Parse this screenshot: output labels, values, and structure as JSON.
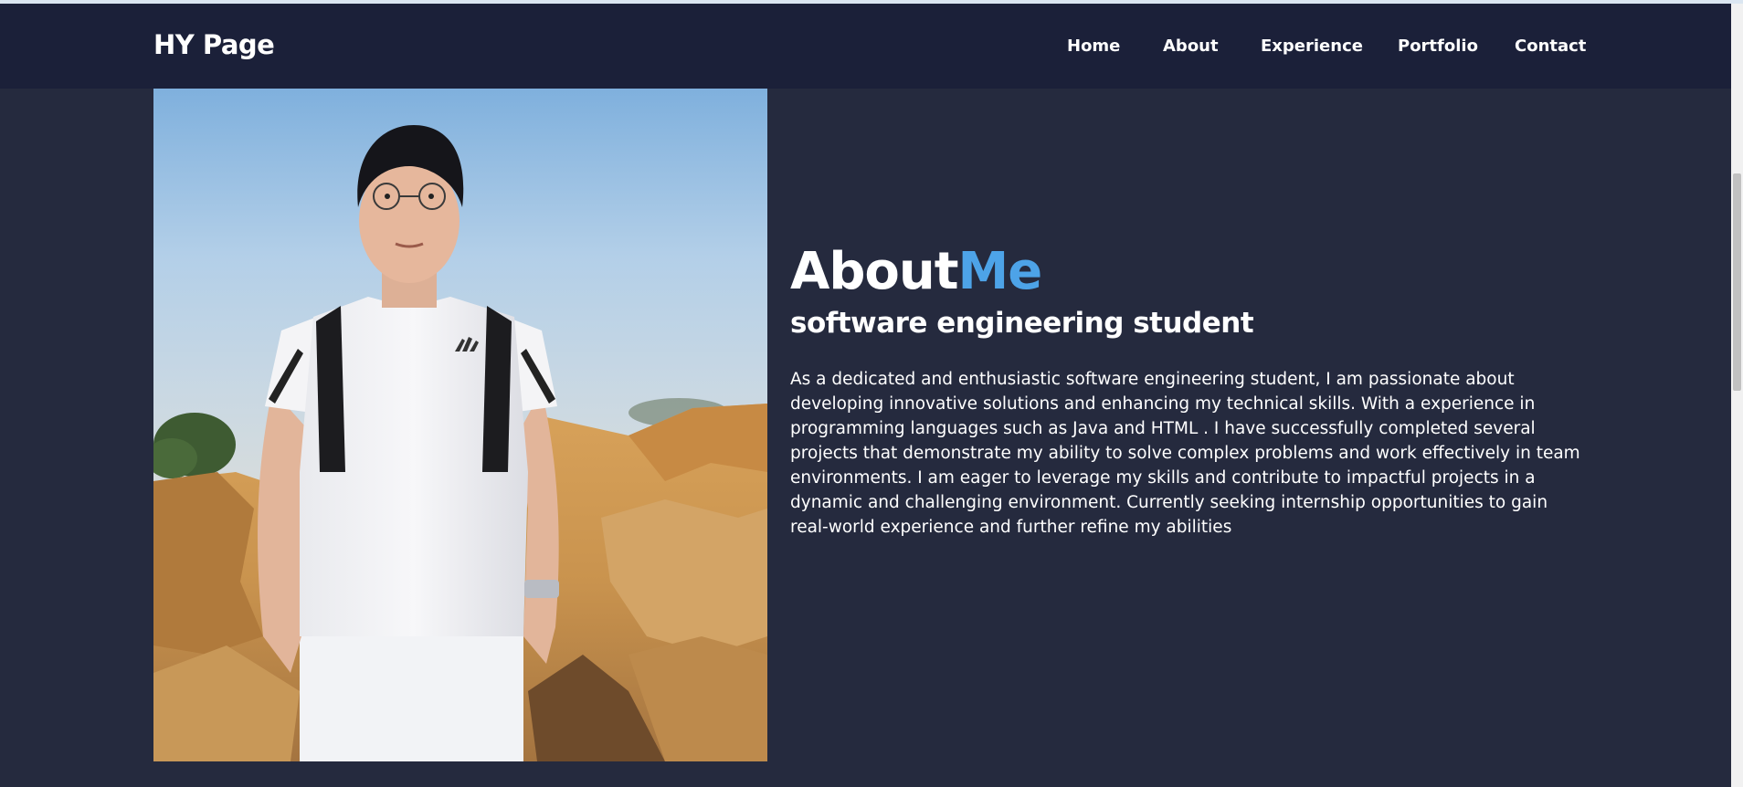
{
  "header": {
    "brand": "HY Page",
    "nav": [
      "Home",
      "About",
      "Experience",
      "Portfolio",
      "Contact"
    ]
  },
  "about": {
    "title_main": "About",
    "title_accent": "Me",
    "subtitle": "software engineering student",
    "bio": "As a dedicated and enthusiastic software engineering student, I am passionate about developing innovative solutions and enhancing my technical skills. With a experience in programming languages such as Java and HTML . I have successfully completed several projects that demonstrate my ability to solve complex problems and work effectively in team environments. I am eager to leverage my skills and contribute to impactful projects in a dynamic and challenging environment. Currently seeking internship opportunities to gain real-world experience and further refine my abilities",
    "photo": {
      "subject": "profile-photo",
      "shirt_logo": "adidas"
    }
  },
  "colors": {
    "page_bg": "#252a3e",
    "navbar_bg": "#1b2039",
    "accent": "#4da3e8",
    "text": "#ffffff"
  }
}
